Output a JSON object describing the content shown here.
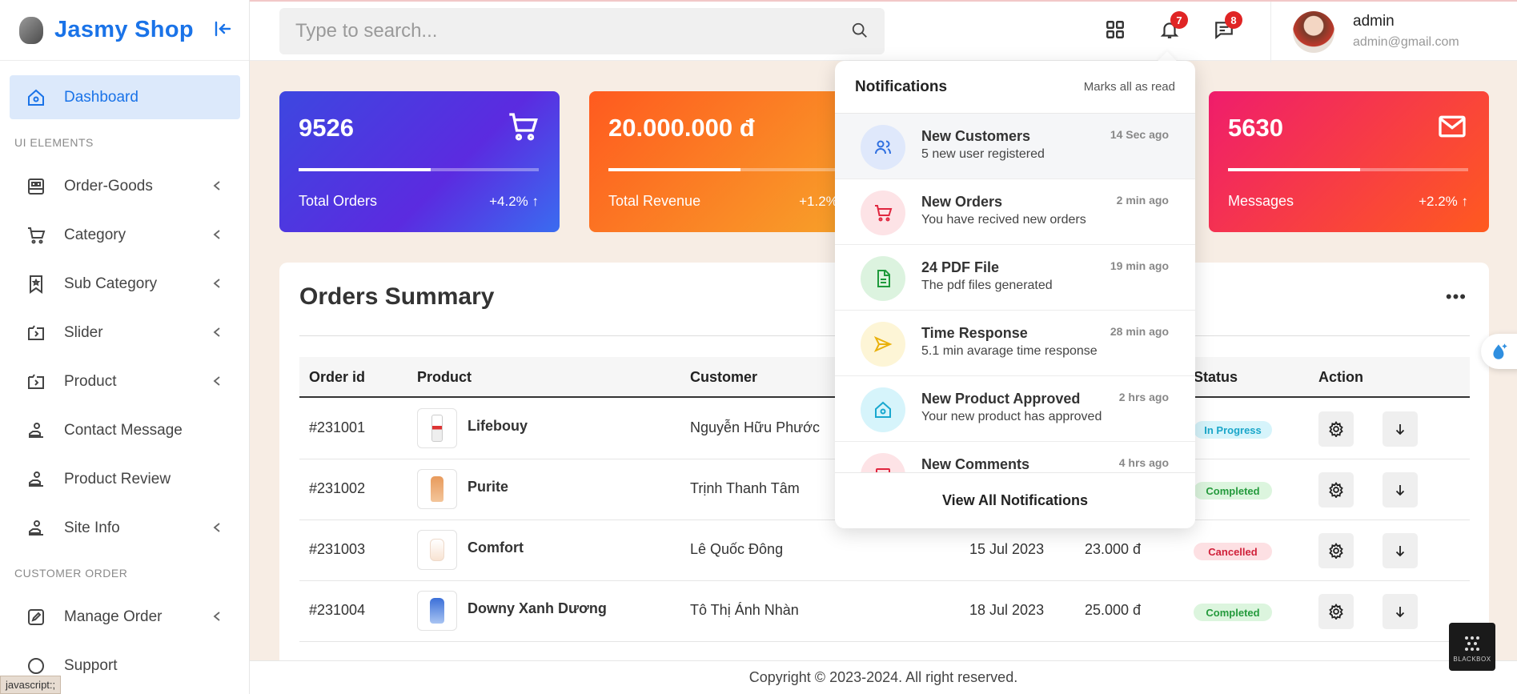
{
  "brand": {
    "name": "Jasmy Shop"
  },
  "sidebar": {
    "items": [
      {
        "label": "Dashboard",
        "icon": "home-icon",
        "active": true
      },
      {
        "label": "Order-Goods",
        "icon": "order-icon"
      },
      {
        "label": "Category",
        "icon": "cart-icon"
      },
      {
        "label": "Sub Category",
        "icon": "bookmark-icon"
      },
      {
        "label": "Slider",
        "icon": "slider-icon"
      },
      {
        "label": "Product",
        "icon": "product-icon"
      },
      {
        "label": "Contact Message",
        "icon": "hand-icon"
      },
      {
        "label": "Product Review",
        "icon": "hand-icon"
      },
      {
        "label": "Site Info",
        "icon": "hand-icon"
      },
      {
        "label": "Manage Order",
        "icon": "edit-icon"
      },
      {
        "label": "Support",
        "icon": "support-icon"
      }
    ],
    "section_ui": "UI ELEMENTS",
    "section_customer": "CUSTOMER ORDER"
  },
  "status_tip": "javascript:;",
  "search": {
    "placeholder": "Type to search..."
  },
  "topbar": {
    "notif_count": "7",
    "msg_count": "8"
  },
  "user": {
    "name": "admin",
    "email": "admin@gmail.com"
  },
  "cards": [
    {
      "value": "9526",
      "label": "Total Orders",
      "pct": "+4.2% ↑",
      "progress": 0.55
    },
    {
      "value": "20.000.000 đ",
      "label": "Total Revenue",
      "pct": "+1.2% ↑",
      "progress": 0.55
    },
    {
      "value": "5630",
      "label": "Messages",
      "pct": "+2.2% ↑",
      "progress": 0.55
    }
  ],
  "orders": {
    "title": "Orders Summary",
    "columns": {
      "id": "Order id",
      "product": "Product",
      "customer": "Customer",
      "status": "Status",
      "action": "Action"
    },
    "rows": [
      {
        "id": "#231001",
        "product": "Lifebouy",
        "customer": "Nguyễn Hữu Phước",
        "date": "",
        "price": "",
        "status": "In Progress"
      },
      {
        "id": "#231002",
        "product": "Purite",
        "customer": "Trịnh Thanh Tâm",
        "date": "",
        "price": "",
        "status": "Completed"
      },
      {
        "id": "#231003",
        "product": "Comfort",
        "customer": "Lê Quốc Đông",
        "date": "15 Jul 2023",
        "price": "23.000 đ",
        "status": "Cancelled"
      },
      {
        "id": "#231004",
        "product": "Downy Xanh Dương",
        "customer": "Tô Thị Ánh Nhàn",
        "date": "18 Jul 2023",
        "price": "25.000 đ",
        "status": "Completed"
      }
    ]
  },
  "footer": {
    "text": "Copyright © 2023-2024. All right reserved."
  },
  "notifications": {
    "title": "Notifications",
    "mark_all": "Marks all as read",
    "view_all": "View All Notifications",
    "items": [
      {
        "title": "New Customers",
        "sub": "5 new user registered",
        "time": "14 Sec ago",
        "icon": "users-icon"
      },
      {
        "title": "New Orders",
        "sub": "You have recived new orders",
        "time": "2 min ago",
        "icon": "cart-icon"
      },
      {
        "title": "24 PDF File",
        "sub": "The pdf files generated",
        "time": "19 min ago",
        "icon": "file-icon"
      },
      {
        "title": "Time Response",
        "sub": "5.1 min avarage time response",
        "time": "28 min ago",
        "icon": "send-icon"
      },
      {
        "title": "New Product Approved",
        "sub": "Your new product has approved",
        "time": "2 hrs ago",
        "icon": "home-icon"
      },
      {
        "title": "New Comments",
        "sub": "",
        "time": "4 hrs ago",
        "icon": "comment-icon"
      }
    ]
  },
  "blackbox_label": "BLACKBOX"
}
